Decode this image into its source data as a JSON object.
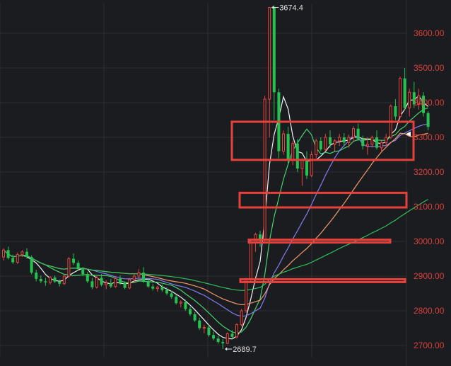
{
  "chart_data": {
    "type": "candlestick",
    "y_axis": {
      "position": "right",
      "ylim": [
        2670,
        3700
      ],
      "ticks": [
        2700,
        2800,
        2900,
        3000,
        3100,
        3200,
        3300,
        3400,
        3500,
        3600
      ],
      "tick_labels": [
        "2700.00",
        "2800.00",
        "2900.00",
        "3000.00",
        "3100.00",
        "3200.00",
        "3300.00",
        "3400.00",
        "3500.00",
        "3600.00"
      ]
    },
    "grid": true,
    "colors": {
      "background": "#1b1c20",
      "grid": "#2c2d33",
      "up": "#e8453c",
      "down": "#26c24f",
      "tick_text": "#d9413a",
      "annotation": "#e0e0e0",
      "box": "#e8413c",
      "ma5": "#f2f2f2",
      "ma10": "#45d46a",
      "ma20": "#7f7ff0",
      "ma30": "#f29a6a",
      "ma60": "#2fbf5a"
    },
    "candles": [
      [
        2955,
        2980,
        2945,
        2975
      ],
      [
        2975,
        2985,
        2948,
        2952
      ],
      [
        2952,
        2962,
        2935,
        2940
      ],
      [
        2940,
        2968,
        2935,
        2962
      ],
      [
        2962,
        2975,
        2955,
        2970
      ],
      [
        2970,
        2980,
        2950,
        2955
      ],
      [
        2955,
        2960,
        2905,
        2910
      ],
      [
        2910,
        2918,
        2885,
        2892
      ],
      [
        2892,
        2902,
        2880,
        2885
      ],
      [
        2885,
        2895,
        2872,
        2882
      ],
      [
        2882,
        2900,
        2876,
        2896
      ],
      [
        2896,
        2902,
        2880,
        2884
      ],
      [
        2884,
        2890,
        2870,
        2878
      ],
      [
        2878,
        2905,
        2875,
        2900
      ],
      [
        2900,
        2955,
        2895,
        2950
      ],
      [
        2950,
        2965,
        2932,
        2938
      ],
      [
        2938,
        2945,
        2915,
        2920
      ],
      [
        2920,
        2926,
        2900,
        2906
      ],
      [
        2906,
        2912,
        2880,
        2885
      ],
      [
        2885,
        2895,
        2862,
        2868
      ],
      [
        2868,
        2900,
        2864,
        2895
      ],
      [
        2895,
        2906,
        2870,
        2875
      ],
      [
        2875,
        2888,
        2862,
        2880
      ],
      [
        2880,
        2892,
        2865,
        2870
      ],
      [
        2870,
        2898,
        2866,
        2893
      ],
      [
        2893,
        2902,
        2875,
        2880
      ],
      [
        2880,
        2885,
        2862,
        2866
      ],
      [
        2866,
        2895,
        2862,
        2890
      ],
      [
        2890,
        2905,
        2880,
        2900
      ],
      [
        2900,
        2920,
        2892,
        2910
      ],
      [
        2910,
        2926,
        2880,
        2885
      ],
      [
        2885,
        2892,
        2866,
        2870
      ],
      [
        2870,
        2877,
        2858,
        2864
      ],
      [
        2864,
        2872,
        2855,
        2868
      ],
      [
        2868,
        2875,
        2855,
        2860
      ],
      [
        2860,
        2868,
        2845,
        2850
      ],
      [
        2850,
        2858,
        2835,
        2840
      ],
      [
        2840,
        2846,
        2818,
        2822
      ],
      [
        2822,
        2830,
        2810,
        2825
      ],
      [
        2825,
        2832,
        2800,
        2805
      ],
      [
        2805,
        2812,
        2785,
        2790
      ],
      [
        2790,
        2796,
        2768,
        2772
      ],
      [
        2772,
        2780,
        2745,
        2750
      ],
      [
        2750,
        2760,
        2735,
        2752
      ],
      [
        2752,
        2760,
        2725,
        2730
      ],
      [
        2730,
        2740,
        2715,
        2720
      ],
      [
        2720,
        2728,
        2705,
        2710
      ],
      [
        2710,
        2718,
        2690,
        2706
      ],
      [
        2706,
        2738,
        2704,
        2734
      ],
      [
        2734,
        2744,
        2718,
        2725
      ],
      [
        2725,
        2764,
        2720,
        2760
      ],
      [
        2760,
        2805,
        2755,
        2800
      ],
      [
        2800,
        2895,
        2795,
        2890
      ],
      [
        2890,
        3005,
        2885,
        2995
      ],
      [
        2995,
        3025,
        2970,
        3020
      ],
      [
        3020,
        3030,
        2985,
        3005
      ],
      [
        3005,
        3420,
        3000,
        3410
      ],
      [
        3410,
        3674.4,
        3300,
        3674.4
      ],
      [
        3674.4,
        3680,
        3350,
        3430
      ],
      [
        3430,
        3440,
        3240,
        3260
      ],
      [
        3260,
        3320,
        3250,
        3310
      ],
      [
        3310,
        3330,
        3220,
        3235
      ],
      [
        3235,
        3290,
        3220,
        3282
      ],
      [
        3282,
        3295,
        3200,
        3210
      ],
      [
        3210,
        3240,
        3160,
        3235
      ],
      [
        3235,
        3260,
        3180,
        3190
      ],
      [
        3190,
        3260,
        3185,
        3250
      ],
      [
        3250,
        3296,
        3240,
        3290
      ],
      [
        3290,
        3300,
        3260,
        3265
      ],
      [
        3265,
        3310,
        3260,
        3300
      ],
      [
        3300,
        3320,
        3270,
        3280
      ],
      [
        3280,
        3295,
        3260,
        3290
      ],
      [
        3290,
        3310,
        3275,
        3300
      ],
      [
        3300,
        3312,
        3275,
        3285
      ],
      [
        3285,
        3308,
        3270,
        3300
      ],
      [
        3300,
        3332,
        3290,
        3325
      ],
      [
        3325,
        3340,
        3290,
        3295
      ],
      [
        3295,
        3305,
        3265,
        3275
      ],
      [
        3275,
        3300,
        3250,
        3280
      ],
      [
        3280,
        3305,
        3270,
        3300
      ],
      [
        3300,
        3320,
        3265,
        3270
      ],
      [
        3270,
        3290,
        3255,
        3285
      ],
      [
        3285,
        3310,
        3275,
        3300
      ],
      [
        3300,
        3395,
        3295,
        3390
      ],
      [
        3390,
        3410,
        3350,
        3360
      ],
      [
        3360,
        3475,
        3355,
        3470
      ],
      [
        3470,
        3500,
        3380,
        3385
      ],
      [
        3385,
        3440,
        3360,
        3430
      ],
      [
        3430,
        3460,
        3385,
        3395
      ],
      [
        3395,
        3440,
        3380,
        3420
      ],
      [
        3420,
        3430,
        3360,
        3370
      ],
      [
        3370,
        3375,
        3320,
        3330
      ]
    ],
    "moving_averages": [
      {
        "key": "ma5",
        "period": 5
      },
      {
        "key": "ma10",
        "period": 10
      },
      {
        "key": "ma20",
        "period": 20
      },
      {
        "key": "ma30",
        "period": 30
      },
      {
        "key": "ma60",
        "period": 60
      }
    ],
    "annotations": [
      {
        "type": "high",
        "label": "3674.4",
        "value": 3674.4,
        "candle_index": 57
      },
      {
        "type": "low",
        "label": "2689.7",
        "value": 2689.7,
        "candle_index": 47
      }
    ],
    "highlight_zones": [
      {
        "y_from": 3235,
        "y_to": 3345
      },
      {
        "y_from": 3098,
        "y_to": 3140
      },
      {
        "y_from": 2998,
        "y_to": 3005
      },
      {
        "y_from": 2883,
        "y_to": 2891
      }
    ],
    "last_price": 3330
  }
}
